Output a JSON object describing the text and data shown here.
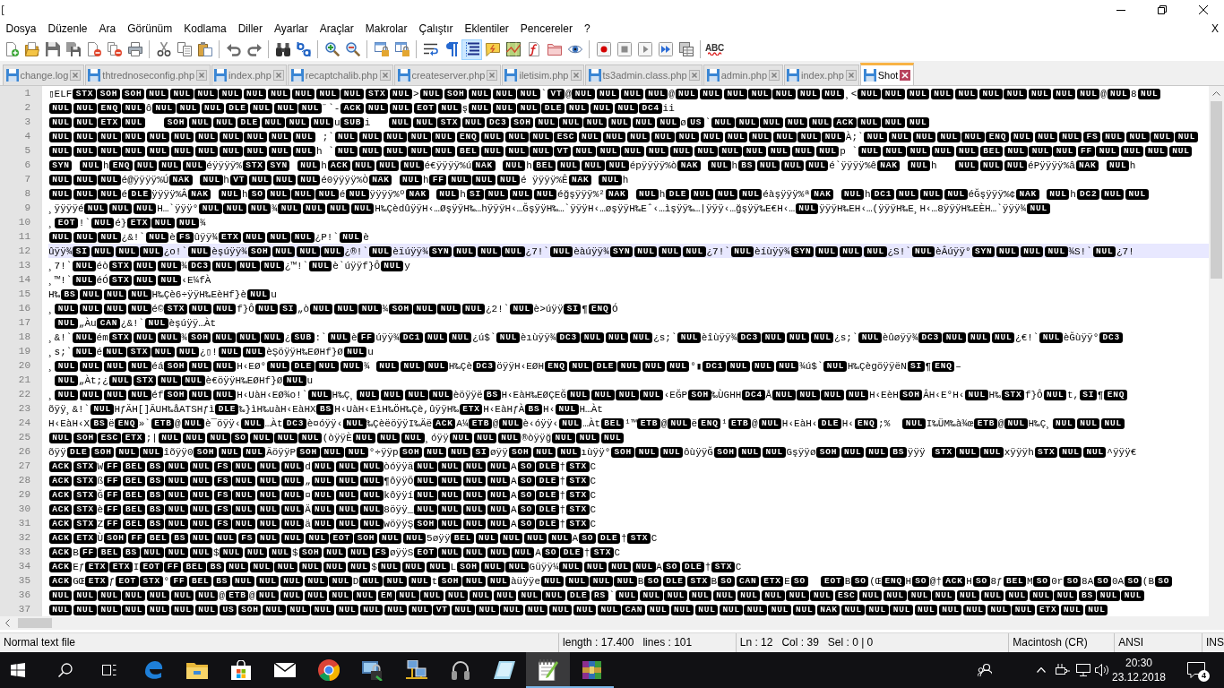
{
  "menu": [
    "Dosya",
    "Düzenle",
    "Ara",
    "Görünüm",
    "Kodlama",
    "Diller",
    "Ayarlar",
    "Araçlar",
    "Makrolar",
    "Çalıştır",
    "Eklentiler",
    "Pencereler",
    "?"
  ],
  "menu_close": "X",
  "toolbar": [
    [
      {
        "active": false
      },
      {
        "active": false
      },
      {
        "active": false
      },
      {
        "active": false
      },
      {
        "active": false
      },
      {
        "active": false
      },
      {
        "active": false
      }
    ],
    [
      {
        "active": false
      },
      {
        "active": false
      },
      {
        "active": false
      }
    ],
    [
      {
        "active": false
      },
      {
        "active": false
      }
    ],
    [
      {
        "active": false
      },
      {
        "active": false
      }
    ],
    [
      {
        "active": false
      },
      {
        "active": false
      }
    ],
    [
      {
        "active": false
      },
      {
        "active": false
      }
    ],
    [
      {
        "active": false
      },
      {
        "active": false
      },
      {
        "active": true
      },
      {
        "active": false
      },
      {
        "active": false
      },
      {
        "active": false
      },
      {
        "active": false
      },
      {
        "active": false
      }
    ],
    [
      {
        "active": false
      },
      {
        "active": false
      },
      {
        "active": false
      },
      {
        "active": false
      },
      {
        "active": false
      }
    ]
  ],
  "spell_check": {
    "label": "ABC"
  },
  "tabs": [
    {
      "label": "change.log",
      "selected": false
    },
    {
      "label": "thtrednoseconfig.php",
      "selected": false
    },
    {
      "label": "index.php",
      "selected": false
    },
    {
      "label": "recaptchalib.php",
      "selected": false
    },
    {
      "label": "createserver.php",
      "selected": false
    },
    {
      "label": "iletisim.php",
      "selected": false
    },
    {
      "label": "ts3admin.class.php",
      "selected": false
    },
    {
      "label": "admin.php",
      "selected": false
    },
    {
      "label": "index.php",
      "selected": false
    },
    {
      "label": "Shot",
      "selected": true
    }
  ],
  "editor": {
    "lines": [
      {
        "number": "1",
        "current": false,
        "segments": [
          "▯ELF",
          [
            "STX",
            "SOH",
            "SOH",
            "NUL",
            "NUL",
            "NUL",
            "NUL",
            "NUL",
            "NUL",
            "NUL",
            "NUL",
            "NUL",
            "STX",
            "NUL"
          ],
          ">",
          [
            "NUL",
            "SOH",
            "NUL",
            "NUL",
            "NUL"
          ],
          "`",
          [
            "VT"
          ],
          "@",
          [
            "NUL",
            "NUL",
            "NUL",
            "NUL"
          ],
          "@",
          [
            "NUL",
            "NUL",
            "NUL",
            "NUL",
            "NUL",
            "NUL",
            "NUL"
          ],
          "¸<",
          [
            "NUL",
            "NUL",
            "NUL",
            "NUL",
            "NUL",
            "NUL",
            "NUL",
            "NUL",
            "NUL",
            "NUL"
          ],
          "@",
          [
            "NUL"
          ],
          "8",
          [
            "NUL"
          ]
        ]
      },
      {
        "number": "2",
        "current": false,
        "segments": [
          [
            "NUL",
            "NUL",
            "ENQ",
            "NUL"
          ],
          "ô",
          [
            "NUL",
            "NUL",
            "NUL",
            "DLE",
            "NUL",
            "NUL",
            "NUL"
          ],
          "˝`-",
          [
            "ACK",
            "NUL",
            "NUL",
            "EOT",
            "NUL"
          ],
          "ş",
          [
            "NUL",
            "NUL",
            "NUL",
            "DLE",
            "NUL",
            "NUL",
            "NUL",
            "DC4"
          ],
          "ii"
        ]
      },
      {
        "number": "3",
        "current": false,
        "segments": [
          [
            "NUL",
            "NUL",
            "ETX",
            "NUL"
          ],
          {
            "gap": true
          },
          {
            "gap": true
          },
          {
            "gap": true
          },
          [
            "SOH",
            "NUL",
            "NUL",
            "DLE",
            "NUL",
            "NUL",
            "NUL"
          ],
          "u",
          [
            "SUB"
          ],
          "i   ",
          [
            "NUL",
            "NUL",
            "STX",
            "NUL",
            "DC3",
            "SOH",
            "NUL",
            "NUL",
            "NUL",
            "NUL",
            "NUL",
            "NUL"
          ],
          "ø",
          [
            "US"
          ],
          "`",
          [
            "NUL",
            "NUL",
            "NUL",
            "NUL",
            "NUL",
            "ACK",
            "NUL",
            "NUL",
            "NUL"
          ]
        ]
      },
      {
        "number": "4",
        "current": false,
        "segments": [
          [
            "NUL",
            "NUL",
            "NUL",
            "NUL",
            "NUL",
            "NUL",
            "NUL",
            "NUL",
            "NUL",
            "NUL",
            "NUL"
          ],
          " ;`",
          [
            "NUL",
            "NUL",
            "NUL",
            "NUL",
            "NUL",
            "ENQ",
            "NUL",
            "NUL",
            "NUL",
            "ESC",
            "NUL",
            "NUL",
            "NUL",
            "NUL",
            "NUL",
            "NUL",
            "NUL",
            "NUL",
            "NUL",
            "NUL",
            "NUL"
          ],
          "À;`",
          [
            "NUL",
            "NUL",
            "NUL",
            "NUL",
            "NUL",
            "ENQ",
            "NUL",
            "NUL",
            "NUL",
            "FS",
            "NUL",
            "NUL",
            "NUL",
            "NUL"
          ]
        ]
      },
      {
        "number": "5",
        "current": false,
        "segments": [
          [
            "NUL",
            "NUL",
            "NUL",
            "NUL",
            "NUL",
            "NUL",
            "NUL",
            "NUL",
            "NUL",
            "NUL",
            "NUL"
          ],
          "h `",
          [
            "NUL",
            "NUL",
            "NUL",
            "NUL",
            "NUL",
            "BEL",
            "NUL",
            "NUL",
            "NUL",
            "VT",
            "NUL",
            "NUL",
            "NUL",
            "NUL",
            "NUL",
            "NUL",
            "NUL",
            "NUL",
            "NUL",
            "NUL",
            "NUL"
          ],
          "p `",
          [
            "NUL",
            "NUL",
            "NUL",
            "NUL",
            "NUL",
            "BEL",
            "NUL",
            "NUL",
            "NUL",
            "FF",
            "NUL",
            "NUL",
            "NUL",
            "NUL"
          ]
        ]
      },
      {
        "number": "6",
        "current": false,
        "segments": [
          [
            "SYN"
          ],
          {
            "gap": true
          },
          [
            "NUL"
          ],
          "h",
          [
            "ENQ",
            "NUL",
            "NUL",
            "NUL"
          ],
          "éÿÿÿÿ%",
          [
            "STX",
            "SYN"
          ],
          {
            "gap": true
          },
          [
            "NUL"
          ],
          "h",
          [
            "ACK",
            "NUL",
            "NUL",
            "NUL"
          ],
          "é€ÿÿÿÿ%ú",
          [
            "NAK"
          ],
          {
            "gap": true
          },
          [
            "NUL"
          ],
          "h",
          [
            "BEL",
            "NUL",
            "NUL",
            "NUL"
          ],
          "épÿÿÿÿ%ò",
          [
            "NAK"
          ],
          {
            "gap": true
          },
          [
            "NUL"
          ],
          "h",
          [
            "BS",
            "NUL",
            "NUL",
            "NUL"
          ],
          "é`ÿÿÿÿ%ê",
          [
            "NAK"
          ],
          {
            "gap": true
          },
          [
            "NUL"
          ],
          "h   ",
          [
            "NUL",
            "NUL",
            "NUL"
          ],
          "éPÿÿÿÿ%â",
          [
            "NAK"
          ],
          {
            "gap": true
          },
          [
            "NUL"
          ],
          "h"
        ]
      },
      {
        "number": "7",
        "current": false,
        "segments": [
          [
            "NUL",
            "NUL",
            "NUL"
          ],
          "é@ÿÿÿÿ%Ú",
          [
            "NAK"
          ],
          {
            "gap": true
          },
          [
            "NUL"
          ],
          "h",
          [
            "VT",
            "NUL",
            "NUL",
            "NUL"
          ],
          "é0ÿÿÿÿ%Ò",
          [
            "NAK"
          ],
          {
            "gap": true
          },
          [
            "NUL"
          ],
          "h",
          [
            "FF",
            "NUL",
            "NUL",
            "NUL"
          ],
          "é ÿÿÿÿ%Ê",
          [
            "NAK"
          ],
          {
            "gap": true
          },
          [
            "NUL"
          ],
          "h"
        ]
      },
      {
        "number": "8",
        "current": false,
        "segments": [
          [
            "NUL",
            "NUL",
            "NUL"
          ],
          "é",
          [
            "DLE"
          ],
          "ÿÿÿÿ%Â",
          [
            "NAK"
          ],
          {
            "gap": true
          },
          [
            "NUL"
          ],
          "h",
          [
            "SO",
            "NUL",
            "NUL",
            "NUL"
          ],
          "é",
          [
            "NUL"
          ],
          "ÿÿÿÿ%º",
          [
            "NAK"
          ],
          {
            "gap": true
          },
          [
            "NUL"
          ],
          "h",
          [
            "SI",
            "NUL",
            "NUL",
            "NUL"
          ],
          "éğşÿÿÿ%²",
          [
            "NAK"
          ],
          {
            "gap": true
          },
          [
            "NUL"
          ],
          "h",
          [
            "DLE",
            "NUL",
            "NUL",
            "NUL"
          ],
          "éàşÿÿÿ%ª",
          [
            "NAK"
          ],
          {
            "gap": true
          },
          [
            "NUL"
          ],
          "h",
          [
            "DC1",
            "NUL",
            "NUL",
            "NUL"
          ],
          "éĞşÿÿÿ%¢",
          [
            "NAK"
          ],
          {
            "gap": true
          },
          [
            "NUL"
          ],
          "h",
          [
            "DC2",
            "NUL",
            "NUL"
          ]
        ]
      },
      {
        "number": "9",
        "current": false,
        "segments": [
          "¸ÿÿÿÿé",
          [
            "NUL",
            "NUL",
            "NUL"
          ],
          "H…`ÿÿÿ°",
          [
            "NUL",
            "NUL",
            "NUL"
          ],
          "¾",
          [
            "NUL",
            "NUL",
            "NUL",
            "NUL"
          ],
          "H‰ÇèdûÿÿH‹…ØşÿÿH‰…hÿÿÿH‹…ĞşÿÿH‰…`ÿÿÿH‹…øşÿÿH‰Eˆ‹…ìşÿÿ‰…|ÿÿÿ‹…ğşÿÿ‰E€H‹…",
          [
            "NUL"
          ],
          "ÿÿÿH‰EH‹…(ÿÿÿH‰E¸H‹…8ÿÿÿH‰EÈH…`ÿÿÿ¾",
          [
            "NUL"
          ]
        ]
      },
      {
        "number": "10",
        "current": false,
        "segments": [
          "¸",
          [
            "EOT"
          ],
          "!`",
          [
            "NUL"
          ],
          "é}",
          [
            "ETX",
            "NUL",
            "NUL"
          ],
          "¾"
        ]
      },
      {
        "number": "11",
        "current": false,
        "segments": [
          [
            "NUL",
            "NUL",
            "NUL"
          ],
          "¿&!`",
          [
            "NUL"
          ],
          "è",
          [
            "FS"
          ],
          "ûÿÿ¾",
          [
            "ETX",
            "NUL",
            "NUL",
            "NUL"
          ],
          "¿P!`",
          [
            "NUL"
          ],
          "è"
        ]
      },
      {
        "number": "12",
        "current": true,
        "segments": [
          "ûÿÿ¾",
          [
            "SI",
            "NUL",
            "NUL",
            "NUL"
          ],
          "¿o!`",
          [
            "NUL"
          ],
          "èşúÿÿ¾",
          [
            "SOH",
            "NUL",
            "NUL",
            "NUL"
          ],
          "¿®!`",
          [
            "NUL"
          ],
          "èïúÿÿ¾",
          [
            "SYN",
            "NUL",
            "NUL",
            "NUL"
          ],
          "¿7!`",
          [
            "NUL"
          ],
          "èàúÿÿ¾",
          [
            "SYN",
            "NUL",
            "NUL",
            "NUL"
          ],
          "¿7!`",
          [
            "NUL"
          ],
          "èíùÿÿ¾",
          [
            "SYN",
            "NUL",
            "NUL",
            "NUL"
          ],
          "¿S!`",
          [
            "NUL"
          ],
          "èÂúÿÿ°",
          [
            "SYN",
            "NUL",
            "NUL",
            "NUL"
          ],
          "¾S!`",
          [
            "NUL"
          ],
          "¿7!"
        ]
      },
      {
        "number": "13",
        "current": false,
        "segments": [
          "¸7!`",
          [
            "NUL"
          ],
          "éò",
          [
            "STX",
            "NUL",
            "NUL"
          ],
          "¾",
          [
            "DC3",
            "NUL",
            "NUL",
            "NUL"
          ],
          "¿™!`",
          [
            "NUL"
          ],
          "è`úÿÿf}Ô",
          [
            "NUL"
          ],
          "y"
        ]
      },
      {
        "number": "14",
        "current": false,
        "segments": [
          "¸™!`",
          [
            "NUL"
          ],
          "éÓ",
          [
            "STX",
            "NUL",
            "NUL"
          ],
          "‹E¼fÀ"
        ]
      },
      {
        "number": "15",
        "current": false,
        "segments": [
          "H‰",
          [
            "BS",
            "NUL",
            "NUL",
            "NUL"
          ],
          "H‰Çè6÷ÿÿH‰EèHf}è",
          [
            "NUL"
          ],
          "u"
        ]
      },
      {
        "number": "16",
        "current": false,
        "segments": [
          "¸",
          [
            "NUL",
            "NUL",
            "NUL",
            "NUL"
          ],
          "é©",
          [
            "STX",
            "NUL",
            "NUL"
          ],
          "f}Ô",
          [
            "NUL",
            "SI"
          ],
          "„ò",
          [
            "NUL",
            "NUL",
            "NUL"
          ],
          "¾",
          [
            "SOH",
            "NUL",
            "NUL",
            "NUL"
          ],
          "¿2!`",
          [
            "NUL"
          ],
          "è>úÿÿ",
          [
            "SI"
          ],
          "¶",
          [
            "ENQ"
          ],
          "Ó"
        ]
      },
      {
        "number": "17",
        "current": false,
        "segments": [
          {
            "gap": true
          },
          [
            "NUL"
          ],
          "„Àu",
          [
            "CAN"
          ],
          "¿&!`",
          [
            "NUL"
          ],
          "èşúÿÿ…Àt"
        ]
      },
      {
        "number": "18",
        "current": false,
        "segments": [
          "¸&!`",
          [
            "NUL"
          ],
          "ém",
          [
            "STX",
            "NUL",
            "NUL"
          ],
          "¾",
          [
            "SOH",
            "NUL",
            "NUL",
            "NUL"
          ],
          "¿",
          [
            "SUB"
          ],
          ":`",
          [
            "NUL"
          ],
          "è",
          [
            "FF"
          ],
          "úÿÿ¾",
          [
            "DC1",
            "NUL",
            "NUL"
          ],
          "¿ú$`",
          [
            "NUL"
          ],
          "èıùÿÿ¾",
          [
            "DC3",
            "NUL",
            "NUL",
            "NUL"
          ],
          "¿s;`",
          [
            "NUL"
          ],
          "èîùÿÿ¾",
          [
            "DC3",
            "NUL",
            "NUL",
            "NUL"
          ],
          "¿s;`",
          [
            "NUL"
          ],
          "èûøÿÿ¾",
          [
            "DC3",
            "NUL",
            "NUL",
            "NUL"
          ],
          "¿€!`",
          [
            "NUL"
          ],
          "èĞùÿÿ°",
          [
            "DC3"
          ]
        ]
      },
      {
        "number": "19",
        "current": false,
        "segments": [
          "¸s;`",
          [
            "NUL"
          ],
          "é",
          [
            "NUL",
            "STX",
            "NUL",
            "NUL"
          ],
          "¿▯!",
          [
            "NUL",
            "NUL"
          ],
          "èŞöÿÿH‰EØHf}Ø",
          [
            "NUL"
          ],
          "u"
        ]
      },
      {
        "number": "20",
        "current": false,
        "segments": [
          "¸",
          [
            "NUL",
            "NUL",
            "NUL",
            "NUL"
          ],
          "éá",
          [
            "SOH",
            "NUL",
            "NUL"
          ],
          "H‹EØ°",
          [
            "NUL",
            "DLE",
            "NUL",
            "NUL"
          ],
          "¾ ",
          [
            "NUL",
            "NUL",
            "NUL"
          ],
          "H‰Çè",
          [
            "DC3"
          ],
          "öÿÿH‹EØH",
          [
            "ENQ",
            "NUL",
            "DLE",
            "NUL",
            "NUL",
            "NUL"
          ],
          "°▮",
          [
            "DC1",
            "NUL",
            "NUL",
            "NUL"
          ],
          "¾ú$`",
          [
            "NUL"
          ],
          "H‰ÇègöÿÿëN",
          [
            "SI"
          ],
          "¶",
          [
            "ENQ"
          ],
          "–"
        ]
      },
      {
        "number": "21",
        "current": false,
        "segments": [
          {
            "gap": true
          },
          [
            "NUL"
          ],
          "„Àt;¿",
          [
            "NUL",
            "STX",
            "NUL",
            "NUL"
          ],
          "è€öÿÿH‰EØHf}Ø",
          [
            "NUL"
          ],
          "u"
        ]
      },
      {
        "number": "22",
        "current": false,
        "segments": [
          "¸",
          [
            "NUL",
            "NUL",
            "NUL",
            "NUL"
          ],
          "éf",
          [
            "SOH",
            "NUL",
            "NUL"
          ],
          "H‹UàH‹EØ¾o!`",
          [
            "NUL"
          ],
          "H‰Ç¸",
          [
            "NUL",
            "NUL",
            "NUL",
            "NUL"
          ],
          "èöÿÿë",
          [
            "BS"
          ],
          "H‹EàH‰EØÇEĞ",
          [
            "NUL",
            "NUL",
            "NUL",
            "NUL"
          ],
          "‹EĞP",
          [
            "SOH"
          ],
          "‰ÙGHH",
          [
            "DC4"
          ],
          "Å",
          [
            "NUL",
            "NUL",
            "NUL",
            "NUL"
          ],
          "H‹EèH",
          [
            "SOH"
          ],
          "ÂH‹E°H‹",
          [
            "NUL"
          ],
          "H‰",
          [
            "STX"
          ],
          "f}Ô",
          [
            "NUL"
          ],
          "t,",
          [
            "SI"
          ],
          "¶",
          [
            "ENQ"
          ]
        ]
      },
      {
        "number": "23",
        "current": false,
        "segments": [
          "õÿÿ¸&!`",
          [
            "NUL"
          ],
          "HƒÄH[]ÃUH‰åATSHƒì",
          [
            "DLE"
          ],
          "‰}ìH‰uàH‹EàHX",
          [
            "BS"
          ],
          "H‹UàH‹EìH‰ÖH‰Çè,ûÿÿH‰",
          [
            "ETX"
          ],
          "H‹EàHƒÀ",
          [
            "BS"
          ],
          "H‹",
          [
            "NUL"
          ],
          "H…Àt"
        ]
      },
      {
        "number": "24",
        "current": false,
        "segments": [
          "H‹EàH‹X",
          [
            "BS"
          ],
          "ë",
          [
            "ENQ"
          ],
          "»`",
          [
            "ETB"
          ],
          "@",
          [
            "NUL"
          ],
          "è¯öÿÿ‹",
          [
            "NUL"
          ],
          "…Àt",
          [
            "DC3"
          ],
          "è¤óÿÿ‹",
          [
            "NUL"
          ],
          "‰ÇèëöÿÿI‰Äë",
          [
            "ACK"
          ],
          "A¼",
          [
            "ETB"
          ],
          "@",
          [
            "NUL"
          ],
          "è‹óÿÿ‹",
          [
            "NUL"
          ],
          "…Àt",
          [
            "BEL"
          ],
          "¹™",
          [
            "ETB"
          ],
          "@",
          [
            "NUL"
          ],
          "ë",
          [
            "ENQ"
          ],
          "¹",
          [
            "ETB"
          ],
          "@",
          [
            "NUL"
          ],
          "H‹EàH‹",
          [
            "DLE"
          ],
          "H‹",
          [
            "ENQ"
          ],
          ";%  ",
          [
            "NUL"
          ],
          "I‰ÜM‰à¾œ",
          [
            "ETB"
          ],
          "@",
          [
            "NUL"
          ],
          "H‰Ç¸",
          [
            "NUL",
            "NUL",
            "NUL"
          ]
        ]
      },
      {
        "number": "25",
        "current": false,
        "segments": [
          [
            "NUL",
            "SOH",
            "ESC",
            "ETX"
          ],
          ";|",
          [
            "NUL",
            "NUL",
            "NUL",
            "SO",
            "NUL",
            "NUL",
            "NUL"
          ],
          "(òÿÿÈ",
          [
            "NUL",
            "NUL",
            "NUL"
          ],
          "¸óÿÿ",
          [
            "NUL",
            "NUL",
            "NUL"
          ],
          "®òÿÿğ",
          [
            "NUL",
            "NUL",
            "NUL"
          ]
        ]
      },
      {
        "number": "26",
        "current": false,
        "segments": [
          "õÿÿ",
          [
            "DLE",
            "SOH",
            "NUL",
            "NUL"
          ],
          "îõÿÿ0",
          [
            "SOH",
            "NUL",
            "NUL"
          ],
          "ÃöÿÿP",
          [
            "SOH",
            "NUL",
            "NUL"
          ],
          "°÷ÿÿp",
          [
            "SOH",
            "NUL",
            "NUL",
            "SI"
          ],
          "øÿÿ",
          [
            "SOH",
            "NUL",
            "NUL"
          ],
          "ıùÿÿ°",
          [
            "SOH",
            "NUL",
            "NUL"
          ],
          "ôùÿÿĞ",
          [
            "SOH",
            "NUL",
            "NUL"
          ],
          "Gşÿÿø",
          [
            "SOH",
            "NUL",
            "NUL",
            "BS"
          ],
          "ÿÿÿ ",
          [
            "STX",
            "NUL",
            "NUL"
          ],
          "xÿÿÿh",
          [
            "STX",
            "NUL",
            "NUL"
          ],
          "^ÿÿÿ€"
        ]
      },
      {
        "number": "27",
        "current": false,
        "segments": [
          [
            "ACK",
            "STX"
          ],
          "W",
          [
            "FF",
            "BEL",
            "BS",
            "NUL",
            "NUL",
            "FS",
            "NUL",
            "NUL",
            "NUL"
          ],
          "d",
          [
            "NUL",
            "NUL",
            "NUL"
          ],
          "òóÿÿä",
          [
            "NUL",
            "NUL",
            "NUL",
            "NUL"
          ],
          "A",
          [
            "SO",
            "DLE"
          ],
          "†",
          [
            "STX"
          ],
          "C"
        ]
      },
      {
        "number": "28",
        "current": false,
        "segments": [
          [
            "ACK",
            "STX"
          ],
          "ß",
          [
            "FF",
            "BEL",
            "BS",
            "NUL",
            "NUL",
            "FS",
            "NUL",
            "NUL",
            "NUL"
          ],
          "„",
          [
            "NUL",
            "NUL",
            "NUL"
          ],
          "¶ôÿÿÕ",
          [
            "NUL",
            "NUL",
            "NUL",
            "NUL"
          ],
          "A",
          [
            "SO",
            "DLE"
          ],
          "†",
          [
            "STX"
          ],
          "C"
        ]
      },
      {
        "number": "29",
        "current": false,
        "segments": [
          [
            "ACK",
            "STX"
          ],
          "Ğ",
          [
            "FF",
            "BEL",
            "BS",
            "NUL",
            "NUL",
            "FS",
            "NUL",
            "NUL",
            "NUL"
          ],
          "¤",
          [
            "NUL",
            "NUL",
            "NUL"
          ],
          "kôÿÿí",
          [
            "NUL",
            "NUL",
            "NUL",
            "NUL"
          ],
          "A",
          [
            "SO",
            "DLE"
          ],
          "†",
          [
            "STX"
          ],
          "C"
        ]
      },
      {
        "number": "30",
        "current": false,
        "segments": [
          [
            "ACK",
            "STX"
          ],
          "è",
          [
            "FF",
            "BEL",
            "BS",
            "NUL",
            "NUL",
            "FS",
            "NUL",
            "NUL",
            "NUL"
          ],
          "Ä",
          [
            "NUL",
            "NUL",
            "NUL"
          ],
          "8öÿÿ_",
          [
            "NUL",
            "NUL",
            "NUL",
            "NUL"
          ],
          "A",
          [
            "SO",
            "DLE"
          ],
          "†",
          [
            "STX"
          ],
          "C"
        ]
      },
      {
        "number": "31",
        "current": false,
        "segments": [
          [
            "ACK",
            "STX"
          ],
          "Z",
          [
            "FF",
            "BEL",
            "BS",
            "NUL",
            "NUL",
            "FS",
            "NUL",
            "NUL",
            "NUL"
          ],
          "ä",
          [
            "NUL",
            "NUL",
            "NUL"
          ],
          "wöÿÿŞ",
          [
            "SOH",
            "NUL",
            "NUL",
            "NUL"
          ],
          "A",
          [
            "SO",
            "DLE"
          ],
          "†",
          [
            "STX"
          ],
          "C"
        ]
      },
      {
        "number": "32",
        "current": false,
        "segments": [
          [
            "ACK",
            "ETX"
          ],
          "Ù",
          [
            "SOH",
            "FF",
            "BEL",
            "BS",
            "NUL",
            "NUL",
            "FS",
            "NUL",
            "NUL",
            "NUL",
            "EOT",
            "SOH",
            "NUL",
            "NUL"
          ],
          "5øÿÿ",
          [
            "BEL",
            "NUL",
            "NUL",
            "NUL",
            "NUL"
          ],
          "A",
          [
            "SO",
            "DLE"
          ],
          "†",
          [
            "STX"
          ],
          "C"
        ]
      },
      {
        "number": "33",
        "current": false,
        "segments": [
          [
            "ACK"
          ],
          "B",
          [
            "FF",
            "BEL",
            "BS",
            "NUL",
            "NUL",
            "NUL"
          ],
          "$",
          [
            "NUL",
            "NUL",
            "NUL"
          ],
          "$",
          [
            "SOH",
            "NUL",
            "NUL",
            "FS"
          ],
          "øÿÿS",
          [
            "EOT",
            "NUL",
            "NUL",
            "NUL",
            "NUL"
          ],
          "A",
          [
            "SO",
            "DLE"
          ],
          "†",
          [
            "STX"
          ],
          "C"
        ]
      },
      {
        "number": "34",
        "current": false,
        "segments": [
          [
            "ACK"
          ],
          "Eƒ",
          [
            "ETX",
            "ETX"
          ],
          "I",
          [
            "EOT",
            "FF",
            "BEL",
            "BS",
            "NUL",
            "NUL",
            "NUL",
            "NUL",
            "NUL",
            "NUL"
          ],
          "$",
          [
            "NUL",
            "NUL",
            "NUL"
          ],
          "L",
          [
            "SOH",
            "NUL",
            "NUL"
          ],
          "Güÿÿ¼",
          [
            "NUL",
            "NUL",
            "NUL",
            "NUL"
          ],
          "A",
          [
            "SO",
            "DLE"
          ],
          "†",
          [
            "STX"
          ],
          "C"
        ]
      },
      {
        "number": "35",
        "current": false,
        "segments": [
          [
            "ACK"
          ],
          "GŒ",
          [
            "ETX"
          ],
          "ƒ",
          [
            "EOT",
            "STX"
          ],
          "°",
          [
            "FF",
            "BEL",
            "BS",
            "NUL",
            "NUL",
            "NUL",
            "NUL",
            "NUL"
          ],
          "D",
          [
            "NUL",
            "NUL",
            "NUL"
          ],
          "t",
          [
            "SOH",
            "NUL",
            "NUL"
          ],
          "àüÿÿe",
          [
            "NUL",
            "NUL",
            "NUL",
            "NUL"
          ],
          "B",
          [
            "SO",
            "DLE",
            "STX"
          ],
          "B",
          [
            "SO",
            "CAN",
            "ETX"
          ],
          "E",
          [
            "SO"
          ],
          {
            "gap": true
          },
          {
            "gap": true
          },
          [
            "EOT"
          ],
          "B",
          [
            "SO"
          ],
          "(Œ",
          [
            "ENQ"
          ],
          "H",
          [
            "SO"
          ],
          "@†",
          [
            "ACK"
          ],
          "H",
          [
            "SO"
          ],
          "8ƒ",
          [
            "BEL"
          ],
          "M",
          [
            "SO"
          ],
          "0r",
          [
            "SO"
          ],
          "8A",
          [
            "SO"
          ],
          "0A",
          [
            "SO"
          ],
          "(B",
          [
            "SO"
          ]
        ]
      },
      {
        "number": "36",
        "current": false,
        "segments": [
          [
            "NUL",
            "NUL",
            "NUL",
            "NUL",
            "NUL",
            "NUL",
            "NUL"
          ],
          "@",
          [
            "ETB"
          ],
          "@",
          [
            "NUL",
            "NUL",
            "NUL",
            "NUL",
            "NUL",
            "EM",
            "NUL",
            "NUL",
            "NUL",
            "NUL",
            "NUL",
            "NUL",
            "NUL",
            "DLE",
            "RS"
          ],
          "`",
          [
            "NUL",
            "NUL",
            "NUL",
            "NUL",
            "NUL",
            "NUL",
            "NUL",
            "NUL",
            "NUL",
            "ESC",
            "NUL",
            "NUL",
            "NUL",
            "NUL",
            "NUL",
            "NUL",
            "NUL",
            "NUL",
            "NUL",
            "BS",
            "NUL",
            "NUL"
          ]
        ]
      },
      {
        "number": "37",
        "current": false,
        "segments": [
          [
            "NUL",
            "NUL",
            "NUL",
            "NUL",
            "NUL",
            "NUL",
            "NUL",
            "US",
            "SOH",
            "NUL",
            "NUL",
            "NUL",
            "NUL",
            "NUL",
            "NUL",
            "NUL",
            "VT",
            "NUL",
            "NUL",
            "NUL",
            "NUL",
            "NUL",
            "NUL",
            "NUL",
            "CAN",
            "NUL",
            "NUL",
            "NUL",
            "NUL",
            "NUL",
            "NUL",
            "NUL",
            "NAK",
            "NUL",
            "NUL",
            "NUL",
            "NUL",
            "NUL",
            "NUL",
            "NUL",
            "NUL",
            "ETX",
            "NUL",
            "NUL"
          ]
        ]
      }
    ]
  },
  "status_bar": {
    "file_type": "Normal text file",
    "length": "length : 17.400",
    "lines": "lines : 101",
    "line": "Ln : 12",
    "column": "Col : 39",
    "selection": "Sel : 0 | 0",
    "eol": "Macintosh (CR)",
    "encoding": "ANSI",
    "mode": "INS"
  },
  "taskbar": {
    "buttons": [
      {
        "active": false,
        "running": false
      },
      {
        "active": false,
        "running": false
      },
      {
        "active": false,
        "running": false
      },
      {
        "active": false,
        "running": false
      },
      {
        "active": false,
        "running": false
      },
      {
        "active": false,
        "running": false
      },
      {
        "active": false,
        "running": false
      },
      {
        "active": false,
        "running": false
      },
      {
        "active": false,
        "running": false
      },
      {
        "active": false,
        "running": false
      },
      {
        "active": false,
        "running": false
      },
      {
        "active": false,
        "running": false
      },
      {
        "active": true,
        "running": true
      },
      {
        "active": false,
        "running": true
      }
    ],
    "clock": {
      "time": "20:30",
      "date": "23.12.2018"
    },
    "notification_count": "4"
  }
}
